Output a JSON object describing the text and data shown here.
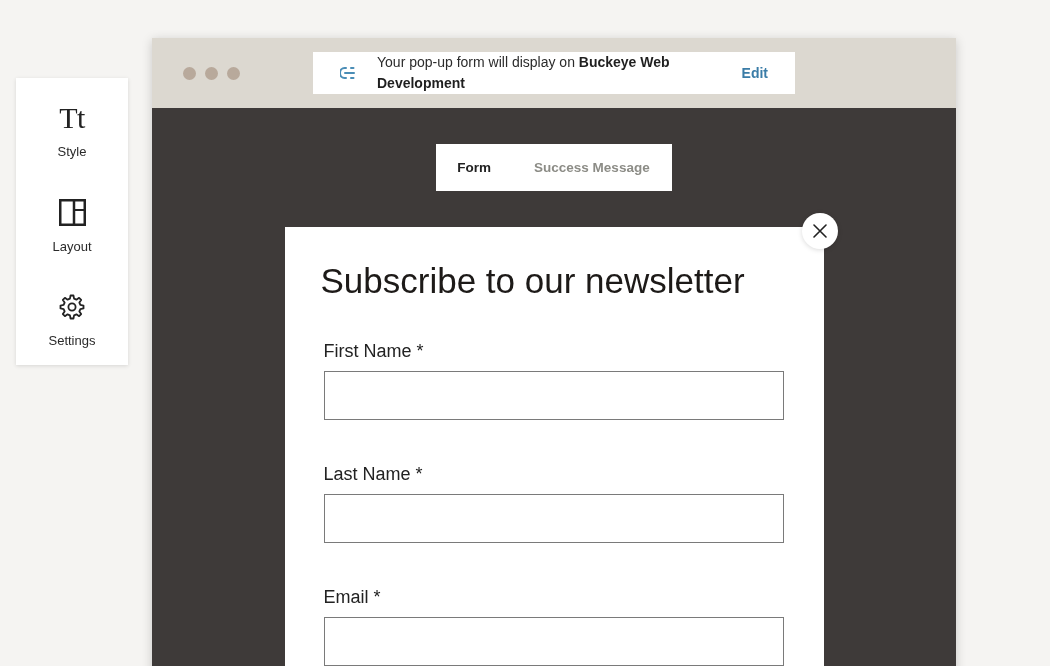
{
  "sidebar": {
    "items": [
      {
        "kind": "glyph",
        "glyph": "Tt",
        "label": "Style"
      },
      {
        "kind": "panels",
        "label": "Layout"
      },
      {
        "kind": "gear",
        "label": "Settings"
      }
    ]
  },
  "browser": {
    "notice": {
      "text": "Your pop-up form will display on **Buckeye Web Development**",
      "action": "Edit"
    }
  },
  "tabs": [
    {
      "label": "Form",
      "selected": true
    },
    {
      "label": "Success Message",
      "selected": false
    }
  ],
  "popup": {
    "title": "Subscribe to our newsletter",
    "fields": [
      {
        "label": "First Name *"
      },
      {
        "label": "Last Name *"
      },
      {
        "label": "Email *"
      }
    ]
  }
}
